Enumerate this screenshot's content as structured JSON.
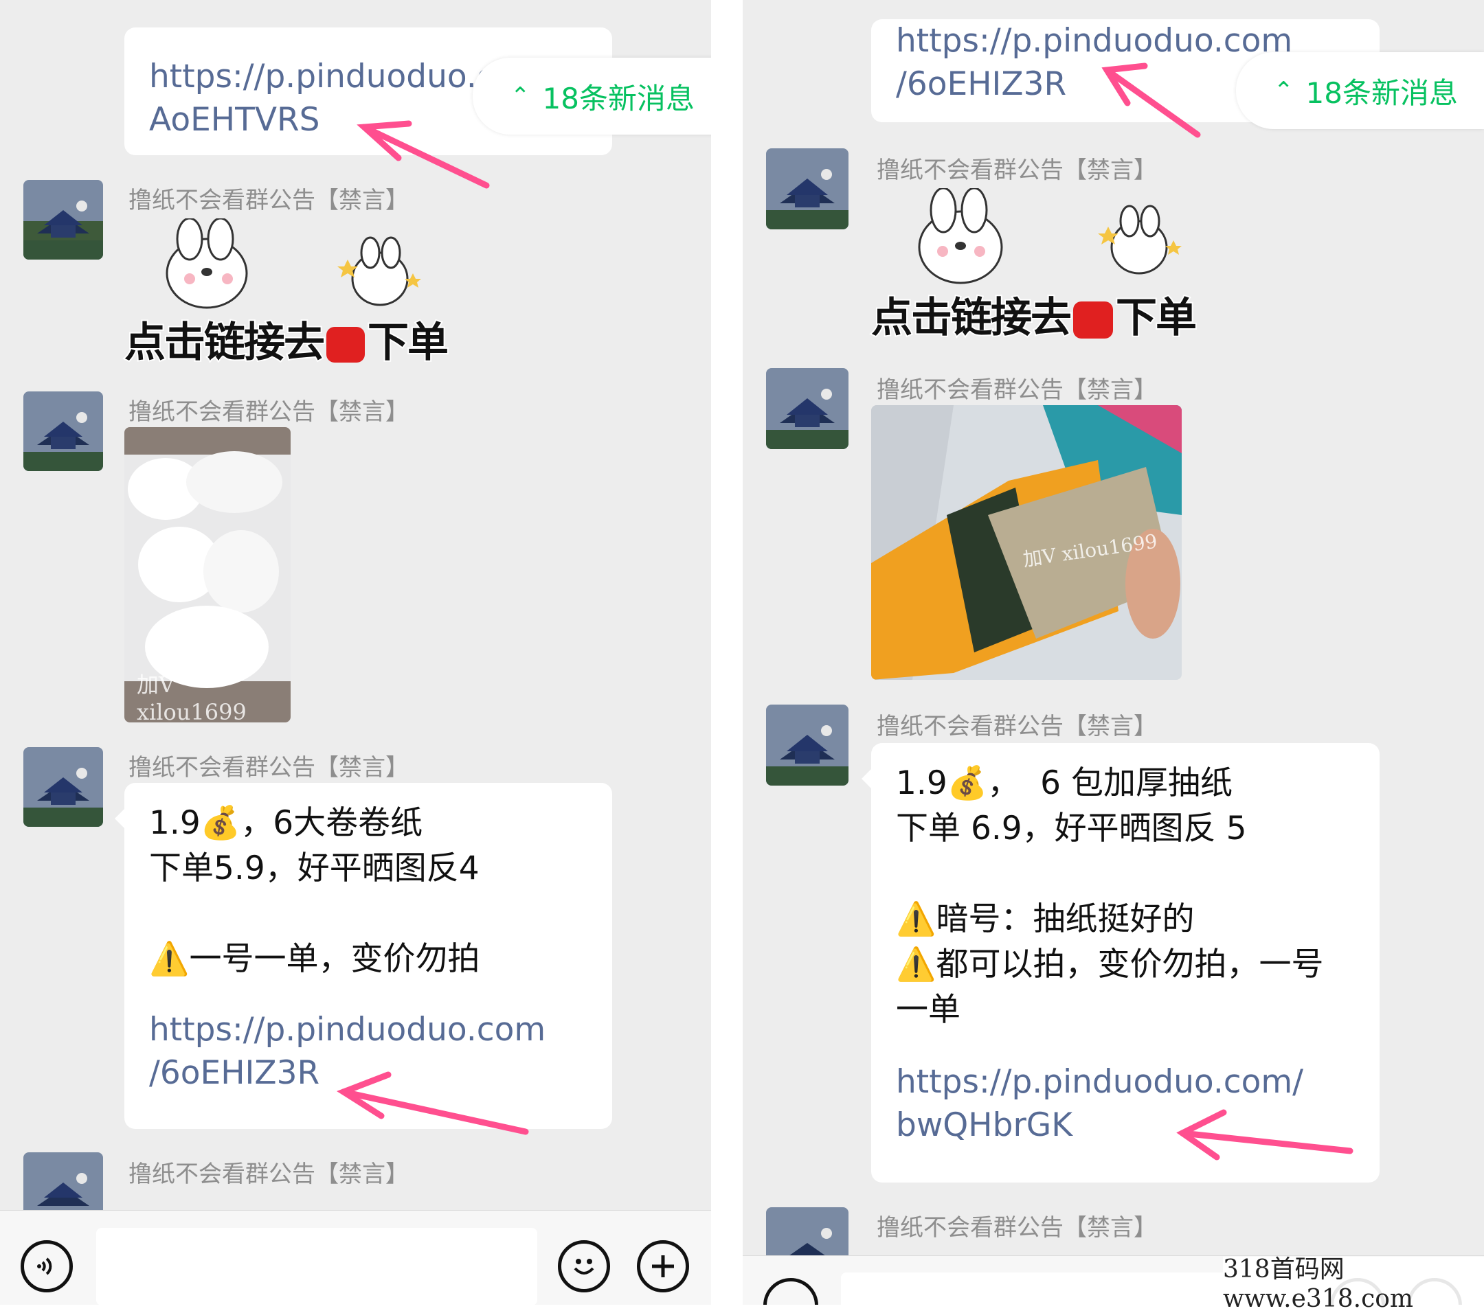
{
  "colors": {
    "chat_bg": "#ededed",
    "link": "#576b95",
    "accent_green": "#07c160",
    "arrow_pink": "#ff4f8f",
    "name_gray": "#8e8e8e"
  },
  "left": {
    "top_link": "https://p.pinduoduo.co\nAoEHTVRS",
    "new_msgs": "18条新消息",
    "sender": "撸纸不会看群公告【禁言】",
    "sticker_text": "点击链接去",
    "sticker_text2": "下单",
    "photo_watermark": "加V  xilou1699",
    "msg_text": "1.9💰，6大卷卷纸\n下单5.9，好平晒图反4\n\n⚠️一号一单，变价勿拍",
    "msg_link": "https://p.pinduoduo.com\n/6oEHIZ3R"
  },
  "right": {
    "top_link": "https://p.pinduoduo.com\n/6oEHIZ3R",
    "new_msgs": "18条新消息",
    "sender": "撸纸不会看群公告【禁言】",
    "sticker_text": "点击链接去",
    "sticker_text2": "下单",
    "photo_watermark": "加V xilou1699",
    "msg_text": "1.9💰，  6 包加厚抽纸\n下单 6.9，好平晒图反 5\n\n⚠️暗号：抽纸挺好的\n⚠️都可以拍，变价勿拍，一号\n一单",
    "msg_link": "https://p.pinduoduo.com/\nbwQHbrGK"
  },
  "page_watermark": "318首码网  www.e318.com",
  "icons": [
    "voice-icon",
    "emoji-icon",
    "plus-icon",
    "chevron-up-icon"
  ]
}
